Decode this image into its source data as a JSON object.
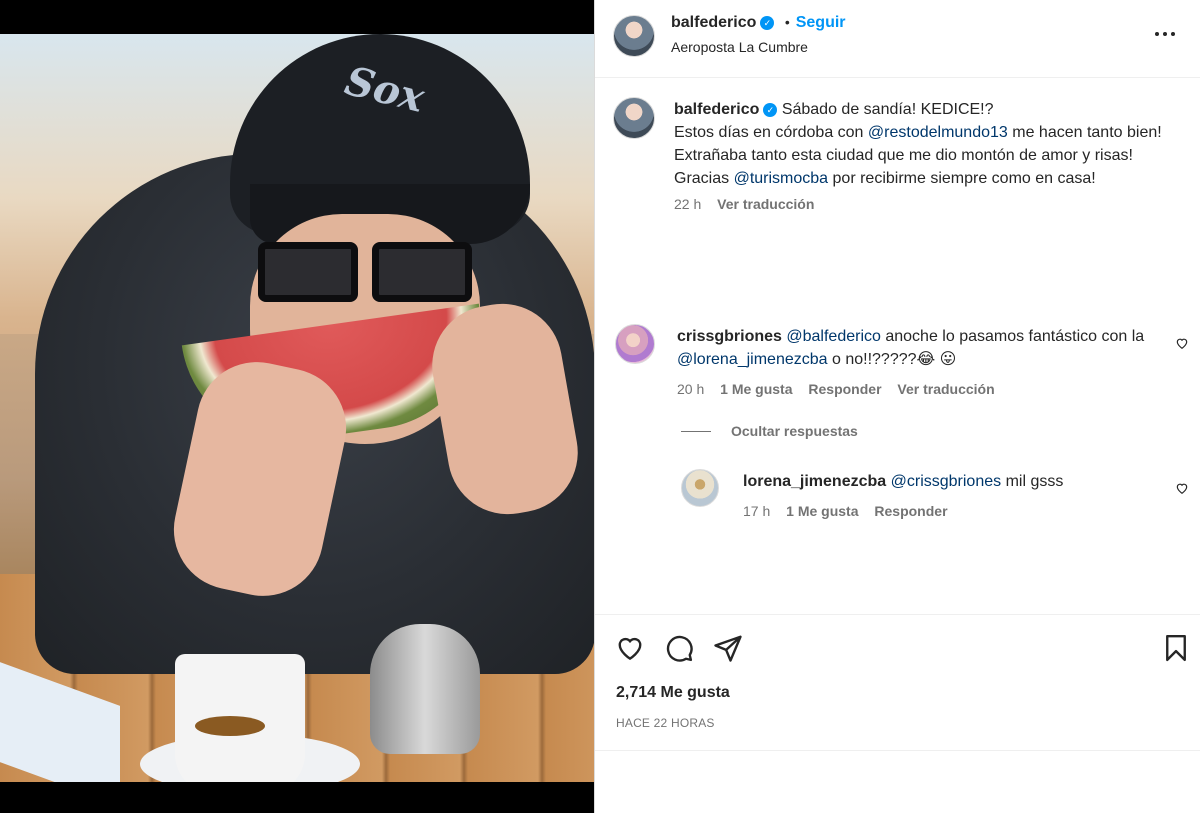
{
  "post": {
    "author": "balfederico",
    "follow_label": "Seguir",
    "location": "Aeroposta La Cumbre",
    "more_label": "...",
    "caption_parts": [
      {
        "text": "Sábado de sandía! KEDICE!?",
        "type": "text"
      }
    ],
    "caption_line2_pre": "Estos días en córdoba con ",
    "caption_mention1": "@restodelmundo13",
    "caption_line2_post": " me hacen tanto bien! Extrañaba tanto esta ciudad que me dio montón de amor y risas! Gracias ",
    "caption_mention2": "@turismocba",
    "caption_end": " por recibirme siempre como en casa!",
    "caption_time": "22 h",
    "caption_translate": "Ver traducción",
    "caption_first": "Sábado de sandía! KEDICE!?"
  },
  "comments": [
    {
      "user": "crissgbriones",
      "mention1": "@balfederico",
      "text1": " anoche lo pasamos fantástico con la ",
      "mention2": "@lorena_jimenezcba",
      "text2": " o no!!?????😂 😛",
      "time": "20 h",
      "likes": "1 Me gusta",
      "reply": "Responder",
      "translate": "Ver traducción",
      "hide_replies": "Ocultar respuestas"
    },
    {
      "user": "lorena_jimenezcba",
      "mention1": "@crissgbriones",
      "text1": " mil gsss",
      "time": "17 h",
      "likes": "1 Me gusta",
      "reply": "Responder"
    }
  ],
  "footer": {
    "likes": "2,714 Me gusta",
    "date": "HACE 22 HORAS"
  },
  "photo": {
    "cap_logo": "Sox"
  },
  "colors": {
    "accent": "#0095f6",
    "mention": "#00376b",
    "meta": "#737373"
  },
  "icons": [
    "like-icon",
    "comment-icon",
    "share-icon",
    "save-icon",
    "more-icon",
    "verified-icon",
    "heart-small-icon"
  ]
}
